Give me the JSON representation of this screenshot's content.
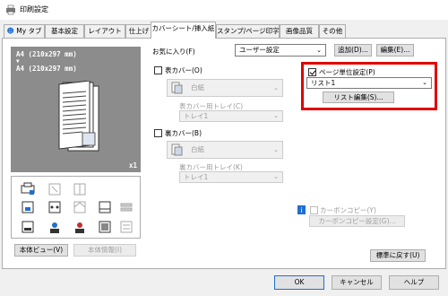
{
  "window": {
    "title": "印刷設定"
  },
  "tabs": [
    {
      "label": "My タブ",
      "active": false
    },
    {
      "label": "基本設定",
      "active": false
    },
    {
      "label": "レイアウト",
      "active": false
    },
    {
      "label": "仕上げ",
      "active": false
    },
    {
      "label": "カバーシート/挿入紙",
      "active": true
    },
    {
      "label": "スタンプ/ページ印字",
      "active": false
    },
    {
      "label": "画像品質",
      "active": false
    },
    {
      "label": "その他",
      "active": false
    }
  ],
  "preview": {
    "line1": "A4 (210x297 mm)",
    "arrow": "▼",
    "line2": "A4 (210x297 mm)",
    "copies": "x1"
  },
  "left_buttons": {
    "view": "本体ビュー(V)",
    "info": "本体情報(I)"
  },
  "favorites": {
    "label": "お気に入り(F)",
    "value": "ユーザー設定",
    "add": "追加(D)...",
    "edit": "編集(E)..."
  },
  "front_cover": {
    "checkbox_label": "表カバー(O)",
    "paper": "白紙",
    "tray_label": "表カバー用トレイ(C)",
    "tray_value": "トレイ1"
  },
  "back_cover": {
    "checkbox_label": "裏カバー(B)",
    "paper": "白紙",
    "tray_label": "裏カバー用トレイ(K)",
    "tray_value": "トレイ1"
  },
  "per_page": {
    "checkbox_label": "ページ単位設定(P)",
    "checked": true,
    "list_value": "リスト1",
    "edit_button": "リスト編集(S)...",
    "highlight_color": "#e00000"
  },
  "carbon": {
    "checkbox_label": "カーボンコピー(Y)",
    "button": "カーボンコピー設定(G)..."
  },
  "defaults_button": "標準に戻す(U)",
  "footer": {
    "ok": "OK",
    "cancel": "キャンセル",
    "help": "ヘルプ"
  },
  "colors": {
    "preview_bg": "#8c8c8c",
    "accent_blue": "#1f6fd0"
  }
}
